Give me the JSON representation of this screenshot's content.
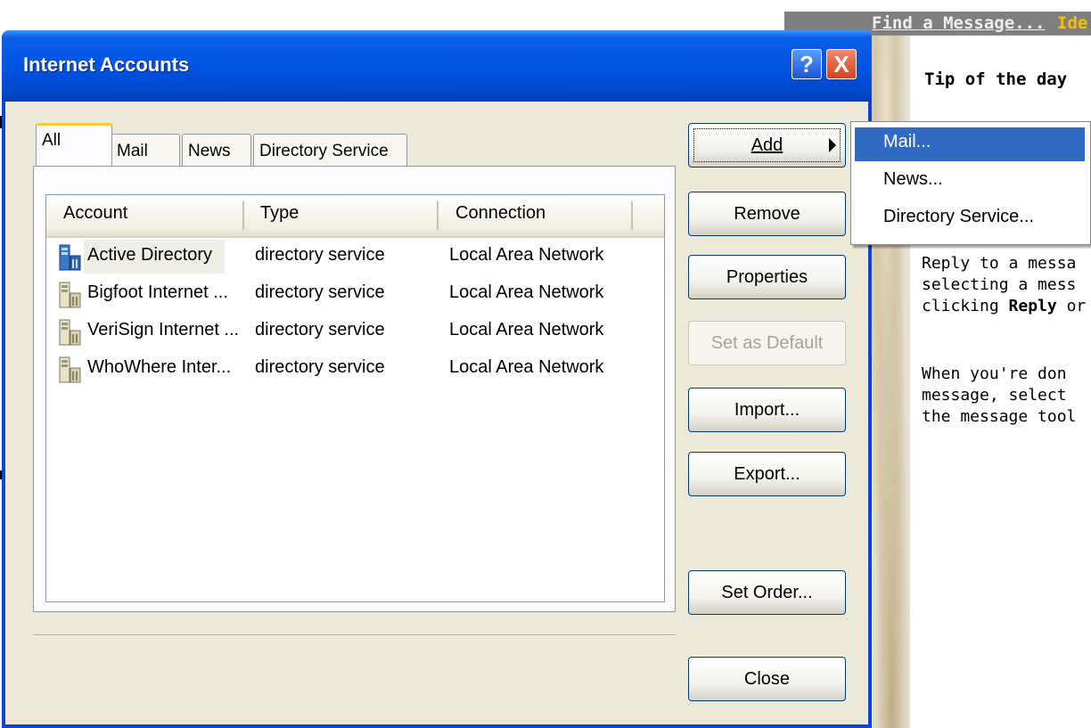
{
  "background": {
    "oe_links": {
      "find": "Find a Message...",
      "partial": "Ide"
    },
    "tip": {
      "title": "Tip of the day",
      "lines": [
        "Reply to a messa",
        "selecting a mess",
        "clicking ",
        "When you're don",
        "message, select",
        "the message tool"
      ],
      "bold_word": "Reply",
      "after_bold": " or"
    }
  },
  "dialog": {
    "title": "Internet Accounts",
    "help_glyph": "?",
    "close_glyph": "X",
    "tabs": [
      {
        "label": "All",
        "active": true
      },
      {
        "label": "Mail",
        "active": false
      },
      {
        "label": "News",
        "active": false
      },
      {
        "label": "Directory Service",
        "active": false
      }
    ],
    "columns": [
      "Account",
      "Type",
      "Connection"
    ],
    "rows": [
      {
        "account": "Active Directory",
        "type": "directory service",
        "connection": "Local Area Network",
        "selected": true
      },
      {
        "account": "Bigfoot Internet ...",
        "type": "directory service",
        "connection": "Local Area Network",
        "selected": false
      },
      {
        "account": "VeriSign Internet ...",
        "type": "directory service",
        "connection": "Local Area Network",
        "selected": false
      },
      {
        "account": "WhoWhere Inter...",
        "type": "directory service",
        "connection": "Local Area Network",
        "selected": false
      }
    ],
    "buttons": {
      "add": "Add",
      "remove": "Remove",
      "properties": "Properties",
      "set_default": "Set as Default",
      "import": "Import...",
      "export": "Export...",
      "set_order": "Set Order...",
      "close": "Close"
    }
  },
  "add_menu": {
    "items": [
      {
        "label": "Mail...",
        "highlighted": true
      },
      {
        "label": "News...",
        "highlighted": false
      },
      {
        "label": "Directory Service...",
        "highlighted": false
      }
    ]
  },
  "colors": {
    "titlebar": "#0054e3",
    "menu_highlight": "#316ac5",
    "tab_accent": "#ffc83c"
  }
}
